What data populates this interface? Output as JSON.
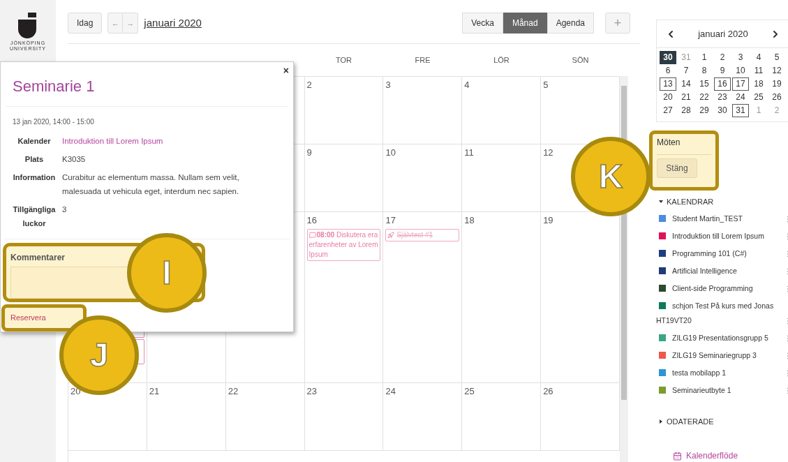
{
  "sidebar": {
    "logo_lines": [
      "JÖNKÖPING",
      "UNIVERSITY"
    ]
  },
  "toolbar": {
    "today_button": "Idag",
    "prev_button": "←",
    "next_button": "→",
    "month_link": "januari 2020",
    "views": [
      {
        "label": "Vecka",
        "selected": false
      },
      {
        "label": "Månad",
        "selected": true
      },
      {
        "label": "Agenda",
        "selected": false
      }
    ],
    "add_button": "+"
  },
  "calendar": {
    "weekdays": [
      "TOR",
      "FRE",
      "LÖR",
      "SÖN"
    ],
    "weeks": [
      {
        "cells": [
          {
            "kind": "covered"
          },
          {
            "kind": "covered"
          },
          {
            "kind": "covered"
          },
          {
            "kind": "day",
            "day": "2"
          },
          {
            "kind": "day",
            "day": "3"
          },
          {
            "kind": "day",
            "day": "4"
          },
          {
            "kind": "day",
            "day": "5"
          }
        ]
      },
      {
        "cells": [
          {
            "kind": "covered"
          },
          {
            "kind": "covered"
          },
          {
            "kind": "covered"
          },
          {
            "kind": "day",
            "day": "9"
          },
          {
            "kind": "day",
            "day": "10"
          },
          {
            "kind": "day",
            "day": "11"
          },
          {
            "kind": "day",
            "day": "12"
          }
        ]
      },
      {
        "cells": [
          {
            "kind": "covered",
            "events": [
              {
                "kind": "covered"
              },
              {
                "kind": "covered"
              }
            ]
          },
          {
            "kind": "covered"
          },
          {
            "kind": "covered"
          },
          {
            "kind": "day",
            "day": "16",
            "events": [
              {
                "kind": "discussion",
                "time": "08:00",
                "title": "Diskutera era erfarenheter av Lorem Ipsum",
                "done": false
              }
            ]
          },
          {
            "kind": "day",
            "day": "17",
            "events": [
              {
                "kind": "quiz",
                "title": "Självtest #1",
                "done": true
              }
            ]
          },
          {
            "kind": "day",
            "day": "18"
          },
          {
            "kind": "day",
            "day": "19"
          }
        ]
      },
      {
        "cells": [
          {
            "kind": "day",
            "day": "20"
          },
          {
            "kind": "day",
            "day": "21"
          },
          {
            "kind": "day",
            "day": "22"
          },
          {
            "kind": "day",
            "day": "23"
          },
          {
            "kind": "day",
            "day": "24"
          },
          {
            "kind": "day",
            "day": "25"
          },
          {
            "kind": "day",
            "day": "26"
          }
        ]
      }
    ]
  },
  "popup": {
    "close_button": "×",
    "title": "Seminarie 1",
    "when": "13 jan 2020, 14:00 - 15:00",
    "details": [
      {
        "label": "Kalender",
        "value": "Introduktion till Lorem Ipsum",
        "kind": "link"
      },
      {
        "label": "Plats",
        "value": "K3035",
        "kind": "text"
      },
      {
        "label": "Information",
        "value": "Curabitur ac elementum massa. Nullam sem velit, malesuada ut vehicula eget, interdum nec sapien.",
        "kind": "text"
      },
      {
        "label": "Tillgängliga luckor",
        "value": "3",
        "kind": "text"
      }
    ],
    "comments": {
      "label": "Kommentarer"
    },
    "reserve_button": "Reservera"
  },
  "callouts": [
    {
      "label": "I"
    },
    {
      "label": "J"
    },
    {
      "label": "K"
    }
  ],
  "mini_calendar": {
    "title": "januari 2020",
    "days": [
      {
        "day": "30",
        "selected": true,
        "has_event": false
      },
      {
        "day": "31",
        "selected": false,
        "has_event": false,
        "outside": true
      },
      {
        "day": "1",
        "selected": false,
        "has_event": false,
        "outside": false
      },
      {
        "day": "2",
        "selected": false,
        "has_event": false,
        "outside": false
      },
      {
        "day": "3",
        "selected": false,
        "has_event": false,
        "outside": false
      },
      {
        "day": "4",
        "selected": false,
        "has_event": false,
        "outside": false
      },
      {
        "day": "5",
        "selected": false,
        "has_event": false,
        "outside": false
      },
      {
        "day": "6",
        "selected": false,
        "has_event": false,
        "outside": false
      },
      {
        "day": "7",
        "selected": false,
        "has_event": false,
        "outside": false
      },
      {
        "day": "8",
        "selected": false,
        "has_event": false,
        "outside": false
      },
      {
        "day": "9",
        "selected": false,
        "has_event": false,
        "outside": false
      },
      {
        "day": "10",
        "selected": false,
        "has_event": false,
        "outside": false
      },
      {
        "day": "11",
        "selected": false,
        "has_event": false,
        "outside": false
      },
      {
        "day": "12",
        "selected": false,
        "has_event": false,
        "outside": false
      },
      {
        "day": "13",
        "selected": false,
        "has_event": true,
        "outside": false
      },
      {
        "day": "14",
        "selected": false,
        "has_event": false,
        "outside": false
      },
      {
        "day": "15",
        "selected": false,
        "has_event": false,
        "outside": false
      },
      {
        "day": "16",
        "selected": false,
        "has_event": true,
        "outside": false
      },
      {
        "day": "17",
        "selected": false,
        "has_event": true,
        "outside": false
      },
      {
        "day": "18",
        "selected": false,
        "has_event": false,
        "outside": false
      },
      {
        "day": "19",
        "selected": false,
        "has_event": false,
        "outside": false
      },
      {
        "day": "20",
        "selected": false,
        "has_event": false,
        "outside": false
      },
      {
        "day": "21",
        "selected": false,
        "has_event": false,
        "outside": false
      },
      {
        "day": "22",
        "selected": false,
        "has_event": false,
        "outside": false
      },
      {
        "day": "23",
        "selected": false,
        "has_event": false,
        "outside": false
      },
      {
        "day": "24",
        "selected": false,
        "has_event": false,
        "outside": false
      },
      {
        "day": "25",
        "selected": false,
        "has_event": false,
        "outside": false
      },
      {
        "day": "26",
        "selected": false,
        "has_event": false,
        "outside": false
      },
      {
        "day": "27",
        "selected": false,
        "has_event": false,
        "outside": false
      },
      {
        "day": "28",
        "selected": false,
        "has_event": false,
        "outside": false
      },
      {
        "day": "29",
        "selected": false,
        "has_event": false,
        "outside": false
      },
      {
        "day": "30",
        "selected": false,
        "has_event": false,
        "outside": false
      },
      {
        "day": "31",
        "selected": false,
        "has_event": true,
        "outside": false
      },
      {
        "day": "1",
        "selected": false,
        "has_event": false,
        "outside": true
      },
      {
        "day": "2",
        "selected": false,
        "has_event": false,
        "outside": true
      }
    ]
  },
  "meetings": {
    "title": "Möten",
    "close_button": "Stäng"
  },
  "calendars": {
    "title": "KALENDRAR",
    "expanded": true,
    "items": [
      {
        "name": "Student Martin_TEST",
        "color": "#4a8ee0"
      },
      {
        "name": "Introduktion till Lorem Ipsum",
        "color": "#e0135a"
      },
      {
        "name": "Programming 101 (C#)",
        "color": "#1f3c80"
      },
      {
        "name": "Artificial Intelligence",
        "color": "#213a78"
      },
      {
        "name": "Client-side Programming",
        "color": "#2f4a2f"
      },
      {
        "name": "schjon Test På kurs med Jonas HT19VT20",
        "color": "#0d7a5a"
      },
      {
        "name": "ZILG19 Presentationsgrupp 5",
        "color": "#3aa585"
      },
      {
        "name": "ZILG19 Seminariegrupp 3",
        "color": "#f0564a"
      },
      {
        "name": "testa mobilapp 1",
        "color": "#2b96d6"
      },
      {
        "name": "Seminarieutbyte 1",
        "color": "#7a9e2b"
      }
    ]
  },
  "undated": {
    "title": "ODATERADE",
    "expanded": false
  },
  "feed_link": "Kalenderflöde"
}
